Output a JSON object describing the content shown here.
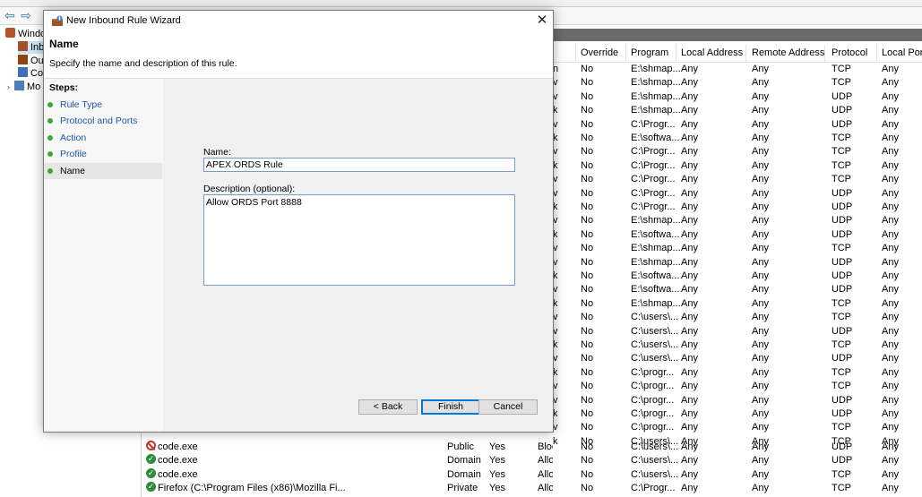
{
  "toolbar": {
    "back_icon": "arrow-left-icon",
    "forward_icon": "arrow-right-icon"
  },
  "tree": {
    "items": [
      {
        "label": "Windo",
        "icon": "firewall-icon"
      },
      {
        "label": "Inb",
        "icon": "inbound-rules-icon"
      },
      {
        "label": "Ou",
        "icon": "outbound-rules-icon"
      },
      {
        "label": "Co",
        "icon": "connection-security-icon"
      },
      {
        "label": "Mo",
        "icon": "monitoring-icon"
      }
    ]
  },
  "grid": {
    "headers": {
      "profile": "",
      "override": "Override",
      "program": "Program",
      "local_address": "Local Address",
      "remote_address": "Remote Address",
      "protocol": "Protocol",
      "local_port": "Local Port"
    },
    "rows": [
      [
        "n",
        "No",
        "E:\\shmap...",
        "Any",
        "Any",
        "TCP",
        "Any"
      ],
      [
        "v",
        "No",
        "E:\\shmap...",
        "Any",
        "Any",
        "TCP",
        "Any"
      ],
      [
        "v",
        "No",
        "E:\\shmap...",
        "Any",
        "Any",
        "UDP",
        "Any"
      ],
      [
        "k",
        "No",
        "E:\\shmap...",
        "Any",
        "Any",
        "UDP",
        "Any"
      ],
      [
        "v",
        "No",
        "C:\\Progr...",
        "Any",
        "Any",
        "UDP",
        "Any"
      ],
      [
        "k",
        "No",
        "E:\\softwa...",
        "Any",
        "Any",
        "TCP",
        "Any"
      ],
      [
        "v",
        "No",
        "C:\\Progr...",
        "Any",
        "Any",
        "TCP",
        "Any"
      ],
      [
        "k",
        "No",
        "C:\\Progr...",
        "Any",
        "Any",
        "TCP",
        "Any"
      ],
      [
        "v",
        "No",
        "C:\\Progr...",
        "Any",
        "Any",
        "TCP",
        "Any"
      ],
      [
        "v",
        "No",
        "C:\\Progr...",
        "Any",
        "Any",
        "UDP",
        "Any"
      ],
      [
        "k",
        "No",
        "C:\\Progr...",
        "Any",
        "Any",
        "UDP",
        "Any"
      ],
      [
        "v",
        "No",
        "E:\\shmap...",
        "Any",
        "Any",
        "UDP",
        "Any"
      ],
      [
        "k",
        "No",
        "E:\\softwa...",
        "Any",
        "Any",
        "UDP",
        "Any"
      ],
      [
        "v",
        "No",
        "E:\\shmap...",
        "Any",
        "Any",
        "TCP",
        "Any"
      ],
      [
        "v",
        "No",
        "E:\\shmap...",
        "Any",
        "Any",
        "UDP",
        "Any"
      ],
      [
        "k",
        "No",
        "E:\\softwa...",
        "Any",
        "Any",
        "UDP",
        "Any"
      ],
      [
        "v",
        "No",
        "E:\\softwa...",
        "Any",
        "Any",
        "UDP",
        "Any"
      ],
      [
        "k",
        "No",
        "E:\\shmap...",
        "Any",
        "Any",
        "TCP",
        "Any"
      ],
      [
        "v",
        "No",
        "C:\\users\\...",
        "Any",
        "Any",
        "TCP",
        "Any"
      ],
      [
        "v",
        "No",
        "C:\\users\\...",
        "Any",
        "Any",
        "UDP",
        "Any"
      ],
      [
        "k",
        "No",
        "C:\\users\\...",
        "Any",
        "Any",
        "TCP",
        "Any"
      ],
      [
        "v",
        "No",
        "C:\\users\\...",
        "Any",
        "Any",
        "UDP",
        "Any"
      ],
      [
        "k",
        "No",
        "C:\\progr...",
        "Any",
        "Any",
        "TCP",
        "Any"
      ],
      [
        "v",
        "No",
        "C:\\progr...",
        "Any",
        "Any",
        "TCP",
        "Any"
      ],
      [
        "v",
        "No",
        "C:\\progr...",
        "Any",
        "Any",
        "UDP",
        "Any"
      ],
      [
        "k",
        "No",
        "C:\\progr...",
        "Any",
        "Any",
        "UDP",
        "Any"
      ],
      [
        "v",
        "No",
        "C:\\progr...",
        "Any",
        "Any",
        "TCP",
        "Any"
      ],
      [
        "k",
        "No",
        "C:\\users\\...",
        "Any",
        "Any",
        "TCP",
        "Any"
      ]
    ]
  },
  "bottom_rows": [
    {
      "icon": "block-icon",
      "name": "code.exe",
      "profile": "Public",
      "enabled": "Yes",
      "action": "Block",
      "override": "No",
      "program": "C:\\users\\...",
      "local_address": "Any",
      "remote_address": "Any",
      "protocol": "UDP",
      "local_port": "Any"
    },
    {
      "icon": "allow-icon",
      "name": "code.exe",
      "profile": "Domain",
      "enabled": "Yes",
      "action": "Allow",
      "override": "No",
      "program": "C:\\users\\...",
      "local_address": "Any",
      "remote_address": "Any",
      "protocol": "UDP",
      "local_port": "Any"
    },
    {
      "icon": "allow-icon",
      "name": "code.exe",
      "profile": "Domain",
      "enabled": "Yes",
      "action": "Allow",
      "override": "No",
      "program": "C:\\users\\...",
      "local_address": "Any",
      "remote_address": "Any",
      "protocol": "TCP",
      "local_port": "Any"
    },
    {
      "icon": "allow-icon",
      "name": "Firefox (C:\\Program Files (x86)\\Mozilla Fi...",
      "profile": "Private",
      "enabled": "Yes",
      "action": "Allow",
      "override": "No",
      "program": "C:\\Progr...",
      "local_address": "Any",
      "remote_address": "Any",
      "protocol": "TCP",
      "local_port": "Any"
    }
  ],
  "wizard": {
    "title": "New Inbound Rule Wizard",
    "heading": "Name",
    "subheading": "Specify the name and description of this rule.",
    "steps_label": "Steps:",
    "steps": [
      {
        "label": "Rule Type"
      },
      {
        "label": "Protocol and Ports"
      },
      {
        "label": "Action"
      },
      {
        "label": "Profile"
      },
      {
        "label": "Name"
      }
    ],
    "current_step": "Name",
    "name_label": "Name:",
    "name_value": "APEX ORDS Rule",
    "description_label": "Description (optional):",
    "description_value": "Allow ORDS Port 8888",
    "buttons": {
      "back": "< Back",
      "finish": "Finish",
      "cancel": "Cancel"
    }
  },
  "colors": {
    "accent": "#0078d7",
    "step_dot": "#3fa535",
    "step_link": "#1a57a8",
    "block": "#c0392b",
    "allow": "#2e8b3a"
  }
}
